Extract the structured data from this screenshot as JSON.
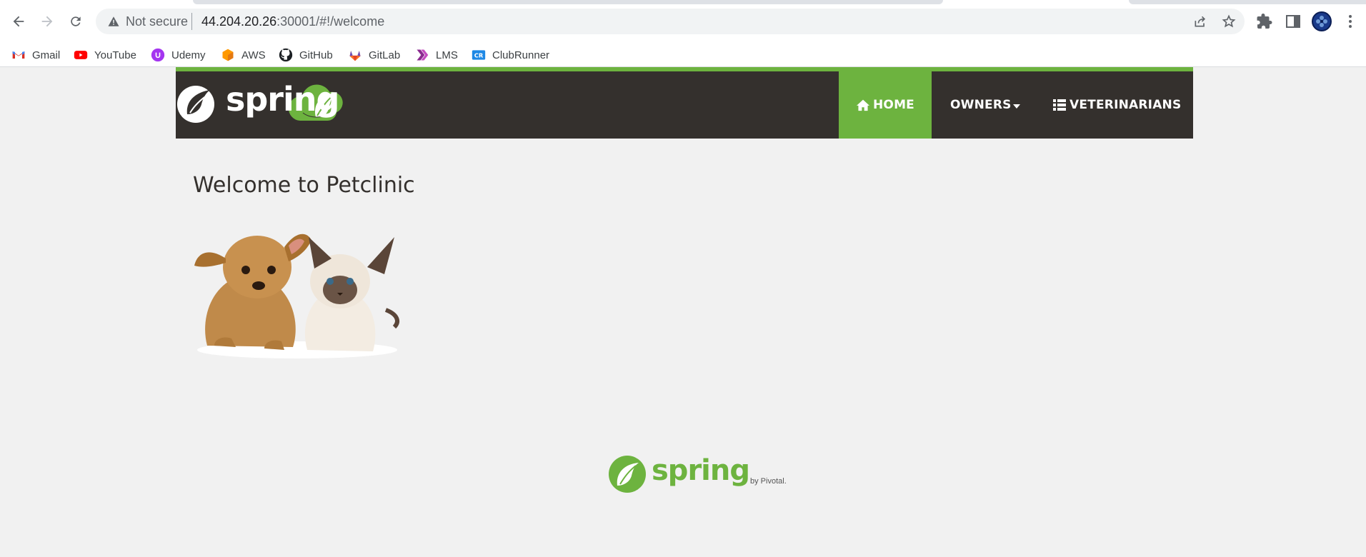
{
  "browser": {
    "security_label": "Not secure",
    "url_host": "44.204.20.26",
    "url_rest": ":30001/#!/welcome"
  },
  "bookmarks": [
    {
      "label": "Gmail",
      "icon": "gmail-icon"
    },
    {
      "label": "YouTube",
      "icon": "youtube-icon"
    },
    {
      "label": "Udemy",
      "icon": "udemy-icon"
    },
    {
      "label": "AWS",
      "icon": "aws-icon"
    },
    {
      "label": "GitHub",
      "icon": "github-icon"
    },
    {
      "label": "GitLab",
      "icon": "gitlab-icon"
    },
    {
      "label": "LMS",
      "icon": "lms-icon"
    },
    {
      "label": "ClubRunner",
      "icon": "clubrunner-icon"
    }
  ],
  "brand": {
    "logo_text": "spring"
  },
  "nav": {
    "home": "HOME",
    "owners": "OWNERS",
    "veterinarians": "VETERINARIANS"
  },
  "main": {
    "title": "Welcome to Petclinic"
  },
  "footer": {
    "logo_text": "spring",
    "byline": "by Pivotal."
  },
  "colors": {
    "accent": "#6db33f",
    "navbar": "#34302d",
    "background": "#f1f1f1"
  }
}
